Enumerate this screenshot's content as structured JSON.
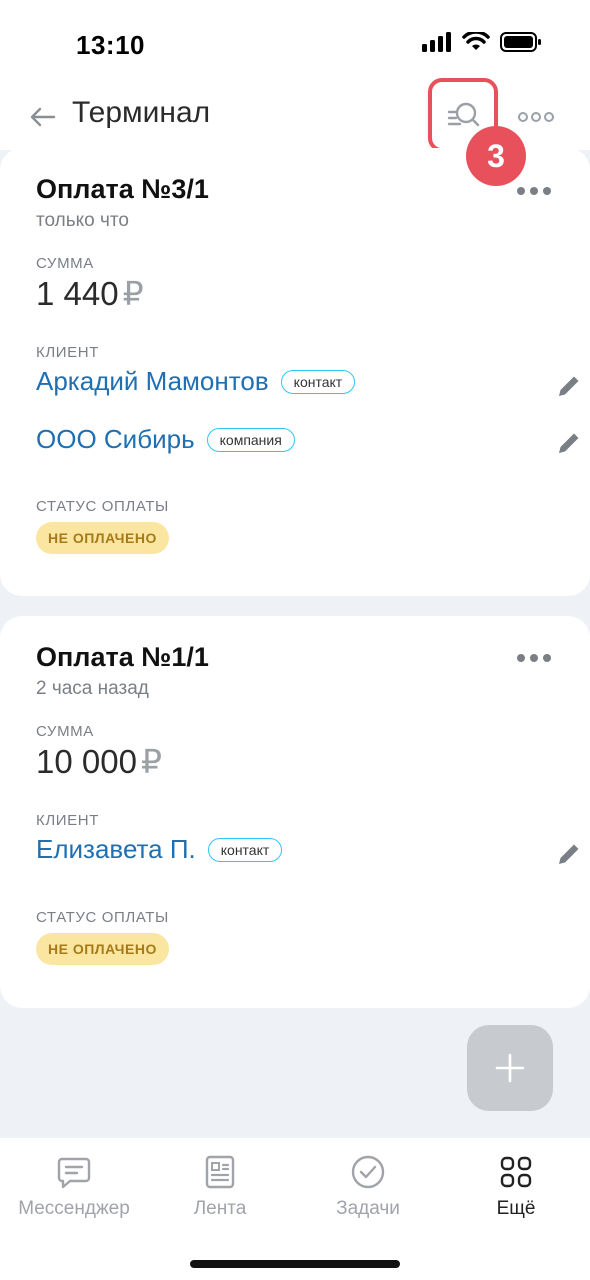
{
  "status_bar": {
    "time": "13:10"
  },
  "header": {
    "title": "Терминал",
    "step_badge": "3"
  },
  "payments": [
    {
      "title": "Оплата №3/1",
      "time": "только что",
      "amount_label": "СУММА",
      "amount": "1 440",
      "currency": "₽",
      "client_label": "КЛИЕНТ",
      "clients": [
        {
          "name": "Аркадий Мамонтов",
          "type": "контакт"
        },
        {
          "name": "ООО Сибирь",
          "type": "компания"
        }
      ],
      "status_label": "СТАТУС ОПЛАТЫ",
      "status": "НЕ ОПЛАЧЕНО"
    },
    {
      "title": "Оплата №1/1",
      "time": "2 часа назад",
      "amount_label": "СУММА",
      "amount": "10 000",
      "currency": "₽",
      "client_label": "КЛИЕНТ",
      "clients": [
        {
          "name": "Елизавета П.",
          "type": "контакт"
        }
      ],
      "status_label": "СТАТУС ОПЛАТЫ",
      "status": "НЕ ОПЛАЧЕНО"
    }
  ],
  "tabbar": {
    "items": [
      {
        "label": "Мессенджер",
        "icon": "chat-icon"
      },
      {
        "label": "Лента",
        "icon": "feed-icon"
      },
      {
        "label": "Задачи",
        "icon": "check-circle-icon"
      },
      {
        "label": "Ещё",
        "icon": "grid-icon"
      }
    ]
  },
  "colors": {
    "accent_red": "#e8515b",
    "link_blue": "#1f6fb3",
    "pill_border": "#2fc6f6",
    "status_bg": "#fbe6a1",
    "status_text": "#a77a18"
  }
}
